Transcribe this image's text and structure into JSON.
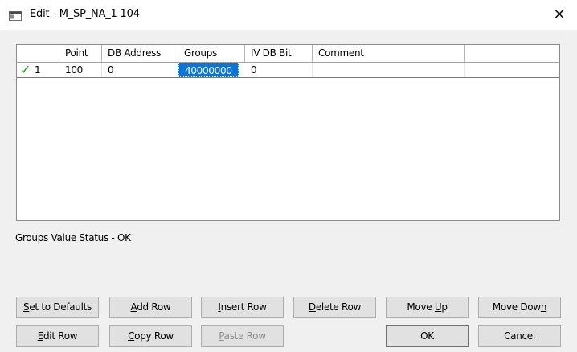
{
  "window": {
    "title": "Edit - M_SP_NA_1 104",
    "icon": "window-icon",
    "close_glyph": "✕"
  },
  "grid": {
    "columns": [
      "",
      "Point",
      "DB Address",
      "Groups",
      "IV DB Bit",
      "Comment",
      ""
    ],
    "rows": [
      {
        "status_icon": "checkmark-icon",
        "status_glyph": "✓",
        "index": "1",
        "point": "100",
        "db_address": "0",
        "groups": "40000000",
        "iv_db_bit": "0",
        "comment": ""
      }
    ],
    "selected_cell": "groups",
    "check_color": "#1a9a1a",
    "selection_color": "#0a74da"
  },
  "status": {
    "text": "Groups Value Status - OK"
  },
  "buttons": {
    "set_defaults": {
      "pre": "",
      "key": "S",
      "post": "et to Defaults"
    },
    "add_row": {
      "pre": "",
      "key": "A",
      "post": "dd Row"
    },
    "insert_row": {
      "pre": "",
      "key": "I",
      "post": "nsert Row"
    },
    "delete_row": {
      "pre": "",
      "key": "D",
      "post": "elete Row"
    },
    "move_up": {
      "pre": "Move ",
      "key": "U",
      "post": "p"
    },
    "move_down": {
      "pre": "Move Dow",
      "key": "n",
      "post": ""
    },
    "edit_row": {
      "pre": "",
      "key": "E",
      "post": "dit Row"
    },
    "copy_row": {
      "pre": "",
      "key": "C",
      "post": "opy Row"
    },
    "paste_row": {
      "pre": "",
      "key": "P",
      "post": "aste Row",
      "disabled": true
    },
    "ok": {
      "label": "OK"
    },
    "cancel": {
      "label": "Cancel"
    }
  }
}
